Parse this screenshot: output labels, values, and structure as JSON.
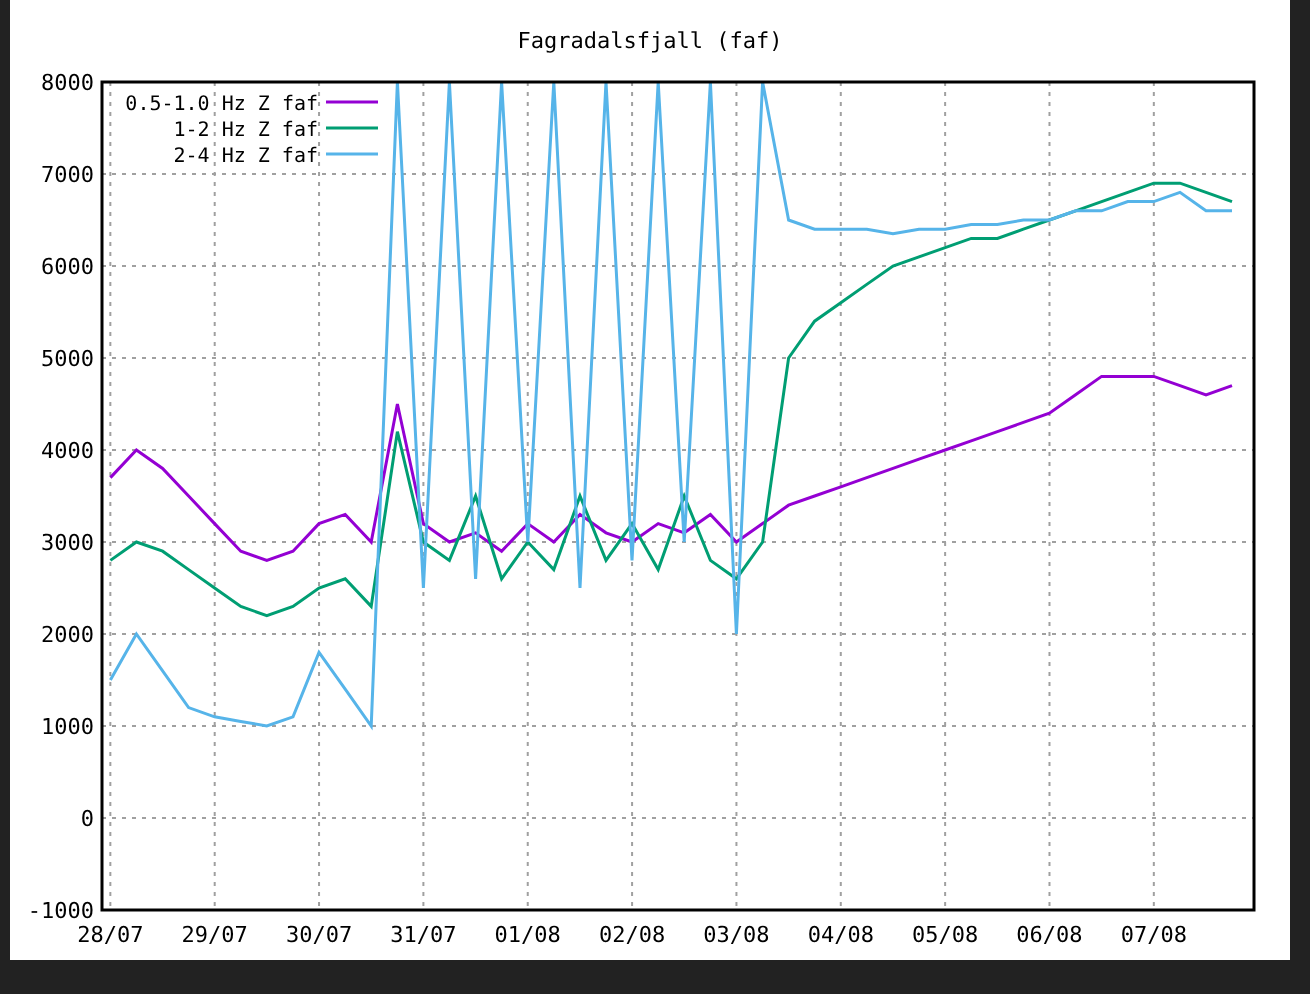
{
  "chart": {
    "chart_data": {
      "type": "line",
      "title": "Fagradalsfjall (faf)",
      "categories": [
        "28/07",
        null,
        null,
        null,
        "29/07",
        null,
        null,
        null,
        "30/07",
        null,
        null,
        null,
        "31/07",
        null,
        null,
        null,
        "01/08",
        null,
        null,
        null,
        "02/08",
        null,
        null,
        null,
        "03/08",
        null,
        null,
        null,
        "04/08",
        null,
        null,
        null,
        "05/08",
        null,
        null,
        null,
        "06/08",
        null,
        null,
        null,
        "07/08",
        null,
        null,
        null
      ],
      "series": [
        {
          "name": "0.5-1.0 Hz Z faf",
          "color": "#9400d3",
          "values": [
            3700,
            4000,
            3800,
            3500,
            3200,
            2900,
            2800,
            2900,
            3200,
            3300,
            3000,
            4500,
            3200,
            3000,
            3100,
            2900,
            3200,
            3000,
            3300,
            3100,
            3000,
            3200,
            3100,
            3300,
            3000,
            3200,
            3400,
            3500,
            3600,
            3700,
            3800,
            3900,
            4000,
            4100,
            4200,
            4300,
            4400,
            4600,
            4800,
            4800,
            4800,
            4700,
            4600,
            4700
          ]
        },
        {
          "name": "1-2 Hz Z faf",
          "color": "#009e73",
          "values": [
            2800,
            3000,
            2900,
            2700,
            2500,
            2300,
            2200,
            2300,
            2500,
            2600,
            2300,
            4200,
            3000,
            2800,
            3500,
            2600,
            3000,
            2700,
            3500,
            2800,
            3200,
            2700,
            3500,
            2800,
            2600,
            3000,
            5000,
            5400,
            5600,
            5800,
            6000,
            6100,
            6200,
            6300,
            6300,
            6400,
            6500,
            6600,
            6700,
            6800,
            6900,
            6900,
            6800,
            6700
          ]
        },
        {
          "name": "2-4 Hz Z faf",
          "color": "#56b4e9",
          "values": [
            1500,
            2000,
            1600,
            1200,
            1100,
            1050,
            1000,
            1100,
            1800,
            1400,
            1000,
            8000,
            2500,
            8000,
            2600,
            8000,
            3000,
            8000,
            2500,
            8000,
            2800,
            8000,
            3000,
            8000,
            2000,
            8000,
            6500,
            6400,
            6400,
            6400,
            6350,
            6400,
            6400,
            6450,
            6450,
            6500,
            6500,
            6600,
            6600,
            6700,
            6700,
            6800,
            6600,
            6600
          ]
        }
      ],
      "ylim": [
        -1000,
        8000
      ],
      "grid": true,
      "legend": "upper left",
      "yticks": [
        -1000,
        0,
        1000,
        2000,
        3000,
        4000,
        5000,
        6000,
        7000,
        8000
      ]
    }
  }
}
